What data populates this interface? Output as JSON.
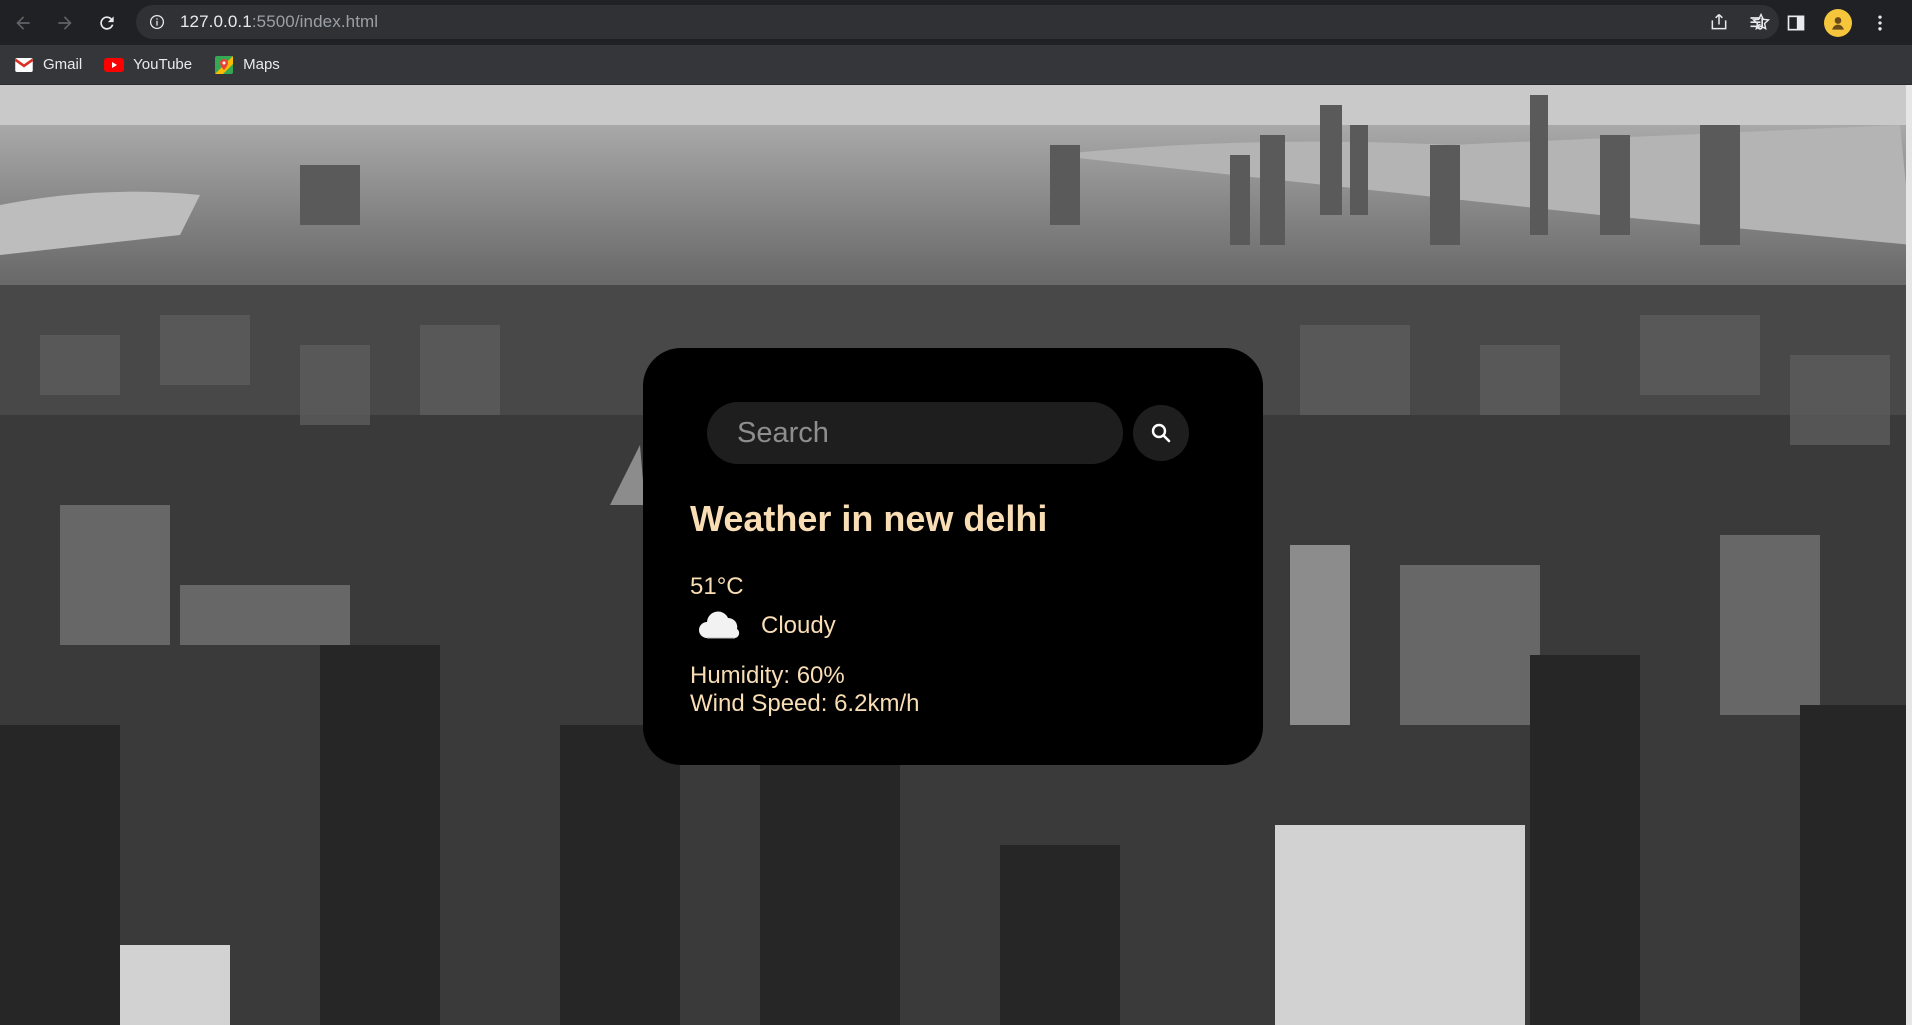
{
  "browser": {
    "url_host": "127.0.0.1",
    "url_rest": ":5500/index.html",
    "bookmarks": [
      {
        "label": "Gmail",
        "icon": "gmail-icon"
      },
      {
        "label": "YouTube",
        "icon": "youtube-icon"
      },
      {
        "label": "Maps",
        "icon": "maps-icon"
      }
    ]
  },
  "weather": {
    "search_placeholder": "Search",
    "city_heading": "Weather in new delhi",
    "temperature": "51°C",
    "description": "Cloudy",
    "weather_icon": "cloud-icon",
    "humidity": "Humidity: 60%",
    "wind": "Wind Speed: 6.2km/h"
  },
  "colors": {
    "card_background": "#000000",
    "card_text": "#f8ddb5",
    "input_background": "#1e1e1e",
    "chrome_dark": "#202124",
    "bookmark_bar": "#35363a"
  }
}
